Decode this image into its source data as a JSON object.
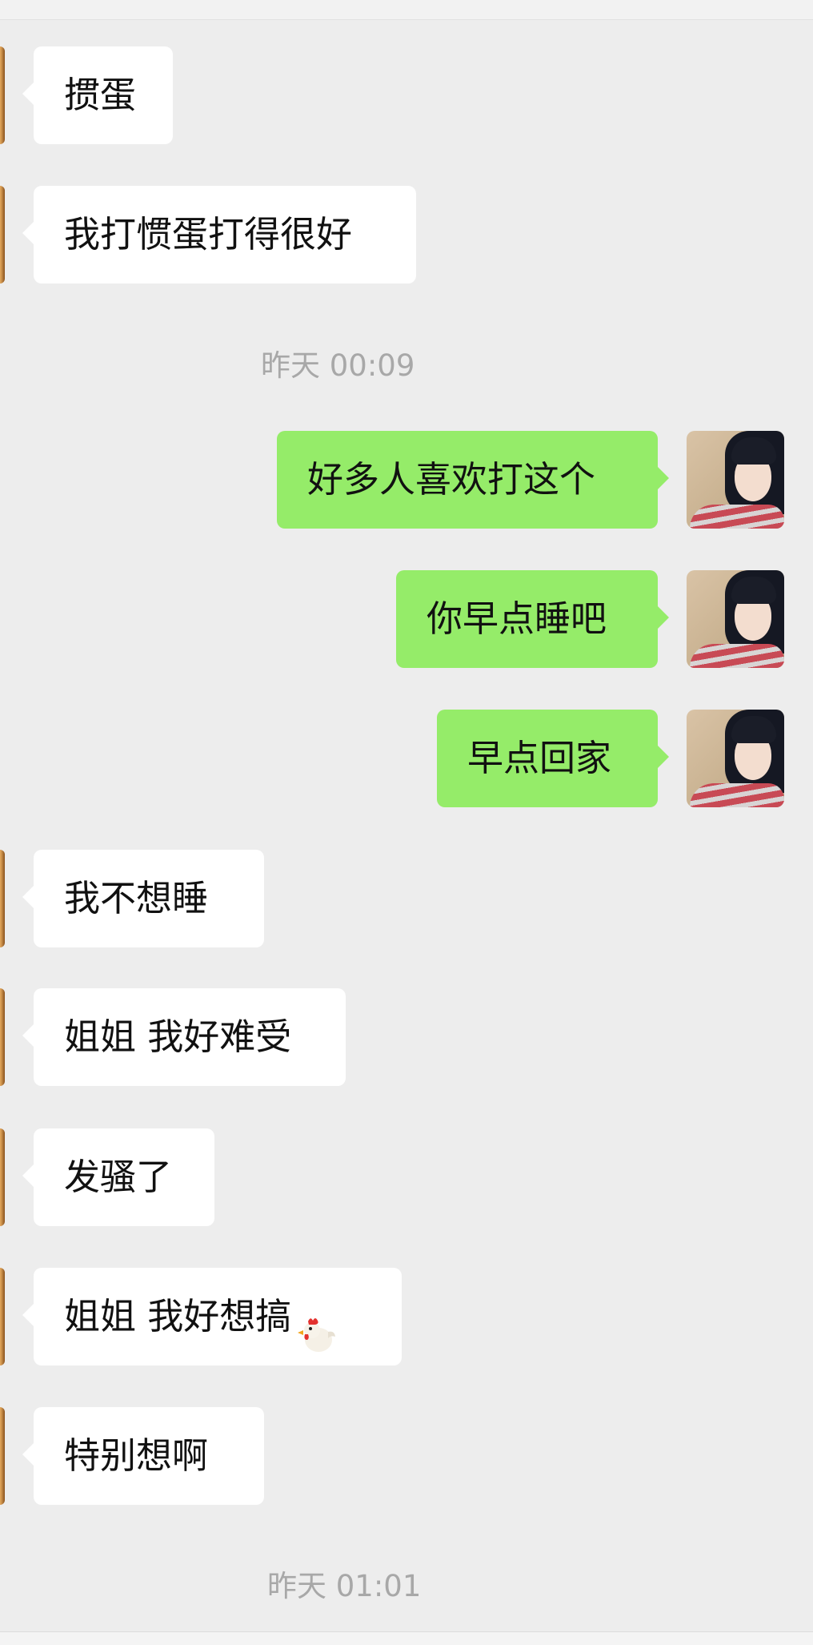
{
  "messages": [
    {
      "side": "left",
      "text": "掼蛋"
    },
    {
      "side": "left",
      "text": "我打惯蛋打得很好"
    },
    {
      "type": "time",
      "text": "昨天 00:09"
    },
    {
      "side": "right",
      "text": "好多人喜欢打这个"
    },
    {
      "side": "right",
      "text": "你早点睡吧"
    },
    {
      "side": "right",
      "text": "早点回家"
    },
    {
      "side": "left",
      "text": "我不想睡"
    },
    {
      "side": "left",
      "text": "姐姐 我好难受"
    },
    {
      "side": "left",
      "text": "发骚了"
    },
    {
      "side": "left",
      "text": "姐姐 我好想搞",
      "emoji": "chicken-icon"
    },
    {
      "side": "left",
      "text": "特别想啊"
    },
    {
      "type": "time",
      "text": "昨天 01:01"
    }
  ],
  "colors": {
    "background": "#ededed",
    "bubble_left": "#ffffff",
    "bubble_right": "#95ec69",
    "timestamp": "#a8a8a8",
    "text": "#111111"
  }
}
